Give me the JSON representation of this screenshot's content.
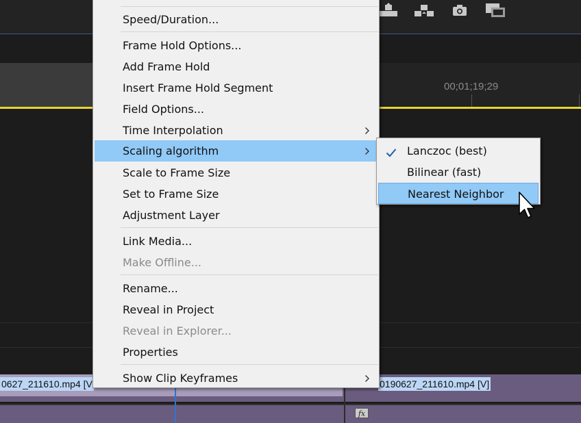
{
  "timeline": {
    "timecode": "00;01;19;29",
    "clip_left_label": "0627_211610.mp4 [V",
    "clip_right_label": "0190627_211610.mp4 [V]",
    "fx_badge": "fx"
  },
  "toolbar_icons": [
    "lift-icon",
    "extract-icon",
    "camera-icon",
    "film-icon"
  ],
  "context_menu": {
    "items": [
      {
        "label": "Speed/Duration...",
        "disabled": false,
        "submenu": false
      },
      {
        "label": "Frame Hold Options...",
        "disabled": false,
        "submenu": false
      },
      {
        "label": "Add Frame Hold",
        "disabled": false,
        "submenu": false
      },
      {
        "label": "Insert Frame Hold Segment",
        "disabled": false,
        "submenu": false
      },
      {
        "label": "Field Options...",
        "disabled": false,
        "submenu": false
      },
      {
        "label": "Time Interpolation",
        "disabled": false,
        "submenu": true
      },
      {
        "label": "Scaling algorithm",
        "disabled": false,
        "submenu": true,
        "highlighted": true
      },
      {
        "label": "Scale to Frame Size",
        "disabled": false,
        "submenu": false
      },
      {
        "label": "Set to Frame Size",
        "disabled": false,
        "submenu": false
      },
      {
        "label": "Adjustment Layer",
        "disabled": false,
        "submenu": false
      },
      {
        "label": "Link Media...",
        "disabled": false,
        "submenu": false
      },
      {
        "label": "Make Offline...",
        "disabled": true,
        "submenu": false
      },
      {
        "label": "Rename...",
        "disabled": false,
        "submenu": false
      },
      {
        "label": "Reveal in Project",
        "disabled": false,
        "submenu": false
      },
      {
        "label": "Reveal in Explorer...",
        "disabled": true,
        "submenu": false
      },
      {
        "label": "Properties",
        "disabled": false,
        "submenu": false
      },
      {
        "label": "Show Clip Keyframes",
        "disabled": false,
        "submenu": true
      }
    ]
  },
  "scaling_submenu": {
    "items": [
      {
        "label": "Lanczoc (best)",
        "checked": true
      },
      {
        "label": "Bilinear (fast)",
        "checked": false
      },
      {
        "label": "Nearest Neighbor",
        "checked": false,
        "highlighted": true
      }
    ]
  },
  "colors": {
    "menu_bg": "#f0f0f0",
    "highlight": "#91c9f7",
    "playhead_line": "#e8d530",
    "clip_purple": "#6a5c7e",
    "check_blue": "#1f5fa8"
  }
}
